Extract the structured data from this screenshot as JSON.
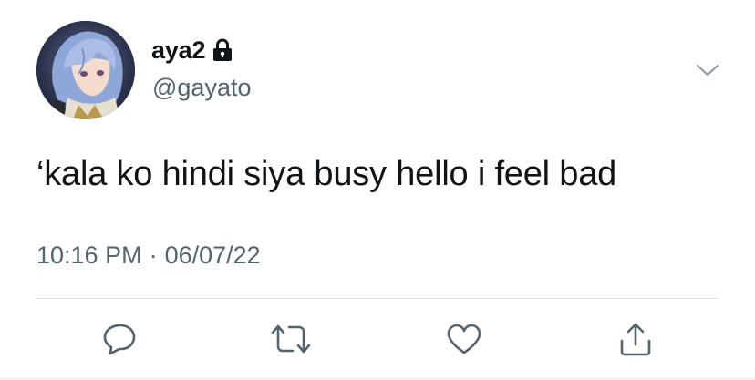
{
  "user": {
    "display_name": "aya2",
    "handle": "@gayato",
    "avatar": "anime-character-avatar",
    "protected_icon": "lock-icon"
  },
  "tweet": {
    "text": "‘kala ko hindi siya busy hello i feel bad",
    "time": "10:16 PM",
    "separator": "·",
    "date": "06/07/22"
  },
  "actions": [
    {
      "icon": "reply-icon"
    },
    {
      "icon": "retweet-icon"
    },
    {
      "icon": "like-icon"
    },
    {
      "icon": "share-icon"
    }
  ],
  "menu": {
    "icon": "chevron-down-icon"
  },
  "colors": {
    "primary_text": "#0f1419",
    "secondary_text": "#536471",
    "divider": "#dfe3e7"
  }
}
